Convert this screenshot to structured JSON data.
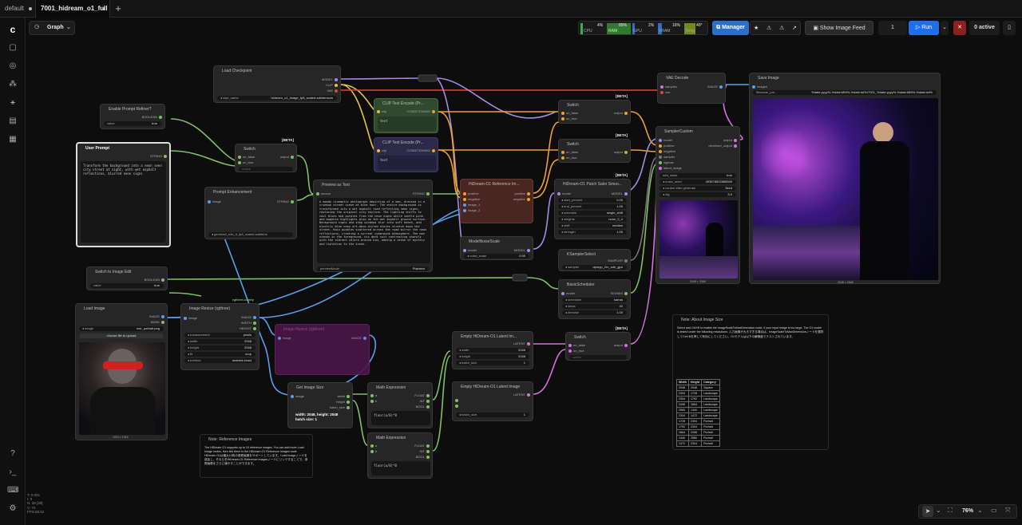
{
  "tabs": {
    "default": "default",
    "active": "7001_hidream_o1_full"
  },
  "toolbar": {
    "graph": "Graph",
    "manager": "Manager",
    "show_feed": "Show Image Feed",
    "run": "Run",
    "queue": "1",
    "active": "0 active",
    "cpu_label": "CPU",
    "cpu_val": "4%",
    "ram_label": "RAM",
    "ram_val": "85%",
    "gpu_label": "GPU",
    "gpu_val": "2%",
    "vram_label": "VRAM",
    "vram_val": "16%",
    "temp_label": "Temp",
    "temp_val": "40°"
  },
  "status": {
    "l1": "T: 0.00s",
    "l2": "I: 0",
    "l3": "N: 28 [28]",
    "l4": "V: 70",
    "l5": "FPS:59.52"
  },
  "zoom": "76%",
  "nodes": {
    "load_checkpoint": {
      "title": "Load Checkpoint",
      "model": "MODEL",
      "clip": "CLIP",
      "vae": "VAE",
      "ckpt_label": "ckpt_name",
      "ckpt_val": "hidream_o1_image_fp8_scaled.safetensors"
    },
    "enable_refiner": {
      "title": "Enable Prompt Refiner?",
      "out": "BOOLEAN",
      "w_label": "value",
      "w_val": "true"
    },
    "user_prompt": {
      "title": "User Prompt",
      "out": "STRING",
      "text": "Transform the background into a neon seen city street at night, with wet asphalt reflections, blurred neon signs"
    },
    "switch1": {
      "title": "Switch",
      "beta": "[BETA]",
      "on_false": "on_false",
      "on_true": "on_true",
      "out": "output",
      "sw": "switch"
    },
    "prompt_enh": {
      "title": "Prompt Enhancement",
      "image": "image",
      "out": "STRING",
      "model_val": "gemma4_e4b_it_fp8_scaled.safetens"
    },
    "preview_text": {
      "title": "Preview as Text",
      "source": "source",
      "out": "STRING",
      "text": "A moody cinematic photograph depicting of a man, dressed in a crimson street scene at blue hour. The entire background is transformed into a wet asphalt road reflecting neon signs, replacing the original city skyline. The lighting shifts to cool blues and purples from the neon signs while subtle pink and magenta highlights glow on the wet asphalt ground surface. Background signs and shop windows blur into soft bokeh, and electric blue neon art-deco-styled stores stretch down the street. Rain puddles scattered across the road mirror the neon reflections, creating a surreal cyberpunk atmosphere. The man stands in the foreground, his dark suit contrasting sharply with the vibrant colors around him, adding a sense of mystery and isolation to the scene.",
      "mode": "previewMode",
      "mode_val": "Plaintext"
    },
    "clip1": {
      "title": "CLIP Text Encode (Pr...",
      "clip": "clip",
      "out": "CONDITIONING",
      "text": "text"
    },
    "clip2": {
      "title": "CLIP Text Encode (Pr...",
      "clip": "clip",
      "out": "CONDITIONING",
      "text": "text"
    },
    "ref_images": {
      "title": "HiDream-O1 Reference Im...",
      "pos": "positive",
      "neg": "negative",
      "i1": "image_1",
      "i2": "image_2",
      "o1": "positive",
      "o2": "negative"
    },
    "switch_a": {
      "title": "Switch",
      "beta": "[BETA]",
      "on_false": "on_false",
      "on_true": "on_true",
      "out": "output",
      "sw_val": "0.81"
    },
    "switch_b": {
      "title": "Switch",
      "beta": "[BETA]",
      "on_false": "on_false",
      "on_true": "on_true",
      "out": "output",
      "sw_val": "0.0"
    },
    "patch": {
      "title": "HiDream-O1 Patch Salor Smoo...",
      "beta": "[BETA]",
      "model": "model",
      "out": "MODEL",
      "rows": [
        [
          "start_percent",
          "0.00"
        ],
        [
          "end_percent",
          "1.00"
        ],
        [
          "schedule",
          "single_shift"
        ],
        [
          "weights",
          "none_0_4"
        ],
        [
          "shift",
          "median"
        ],
        [
          "strength",
          "1.00"
        ]
      ]
    },
    "model_noise": {
      "title": "ModelNoiseScale",
      "model": "model",
      "out": "MODEL",
      "w": "noise_scale",
      "v": "0.95"
    },
    "vae_decode": {
      "title": "VAE Decode",
      "samples": "samples",
      "vae": "vae",
      "out": "IMAGE"
    },
    "sampler_custom": {
      "title": "SamplerCustom",
      "ins": [
        "model",
        "positive",
        "negative",
        "sampler",
        "sigmas",
        "latent_image"
      ],
      "o1": "output",
      "o2": "denoised_output",
      "rows": [
        [
          "add_noise",
          "true"
        ],
        [
          "noise_seed",
          "493578522868549"
        ],
        [
          "control after generate",
          "fixed"
        ],
        [
          "cfg",
          "5.0"
        ]
      ],
      "caption": "2048 × 2048"
    },
    "ksampler_select": {
      "title": "KSamplerSelect",
      "out": "SAMPLER",
      "w": "sampler",
      "v": "dpmpp_2m_sde_gpu"
    },
    "basic_sched": {
      "title": "BasicScheduler",
      "model": "model",
      "out": "SIGMAS",
      "rows": [
        [
          "scheduler",
          "karras"
        ],
        [
          "steps",
          "40"
        ],
        [
          "denoise",
          "1.00"
        ]
      ]
    },
    "save_image": {
      "title": "Save Image",
      "images": "images",
      "prefix": "filename_pre...",
      "prefix_val": "%date:yyyy%-%date:MM%-%date:dd%/7001_%date:yyyy%-%date:MM%-%date:dd%",
      "caption": "2048 × 2048"
    },
    "switch_edit": {
      "title": "Switch to Image Edit",
      "out": "BOOLEAN",
      "w": "value",
      "v": "true"
    },
    "load_image": {
      "title": "Load Image",
      "o1": "IMAGE",
      "o2": "MASK",
      "w": "image",
      "v": "noir_portrait.png",
      "upload": "choose file to upload",
      "caption": "1024 × 1024"
    },
    "resize": {
      "title": "Image Resize (rgthree)",
      "image": "image",
      "o1": "IMAGE",
      "o2": "WIDTH",
      "o3": "HEIGHT",
      "rows": [
        [
          "measurement",
          "pixels"
        ],
        [
          "width",
          "2048"
        ],
        [
          "height",
          "2048"
        ],
        [
          "fit",
          "crop"
        ],
        [
          "method",
          "nearest-exact"
        ]
      ],
      "tag": "rgthree-comfy"
    },
    "bypassed": {
      "title": "Image Resize (rgthree)",
      "image": "image",
      "out": "IMAGE"
    },
    "empty_latent": {
      "title": "Empty HiDream-O1 Latent Im...",
      "out": "LATENT",
      "rows": [
        [
          "width",
          "2048"
        ],
        [
          "height",
          "2048"
        ],
        [
          "batch_size",
          "1"
        ]
      ]
    },
    "switch_c": {
      "title": "Switch",
      "beta": "[BETA]",
      "on_false": "on_false",
      "on_true": "on_true",
      "out": "output",
      "sw": "switch"
    },
    "empty_latent2": {
      "title": "Empty HiDream-O1 Latent Image",
      "out": "LATENT",
      "w": "batch_size",
      "v": "1"
    },
    "get_size": {
      "title": "Get Image Size",
      "image": "image",
      "o1": "width",
      "o2": "height",
      "o3": "batch_size",
      "info": "width: 2048, height: 2048 batch size: 1"
    },
    "math1": {
      "title": "Math Expression",
      "a": "a",
      "b": "b",
      "o1": "FLOAT",
      "o2": "INT",
      "o3": "BOOL",
      "expr": "floor(a/8)*8"
    },
    "math2": {
      "title": "Math Expression",
      "a": "a",
      "b": "b",
      "o1": "FLOAT",
      "o2": "INT",
      "o3": "BOOL",
      "expr": "floor(a/8)*8"
    }
  },
  "notes": {
    "ref": {
      "title": "Note: Reference Images",
      "body": "The HiDream O1 supports up to 10 reference images. You can add more Load Image nodes, then link them to the HiDream-O1 Reference Images node. HiDream O1は最大10枚の参照画像をサポートしています。Load Imageノードを追加し、それらをHiDream-O1 Reference Imagesノードにリンクすることで、参照画像をさらに増やすことができます。"
    },
    "size": {
      "title": "Note: About Image Size",
      "body": "Select and Ctrl+B to enable the ImageScaleToMaxDimension node, if your input image is too large. The O1 model is tested under the following resolutions: 入力画像が大きすぎる場合は、ImageScaleToMaxDimensionノードを選択してCtrl+Bを押して有効にしてください。O1モデルは以下の解像度でテストされています。",
      "table": [
        [
          "Width",
          "Height",
          "Category"
        ],
        [
          "2048",
          "2048",
          "Square"
        ],
        [
          "2304",
          "1728",
          "Landscape"
        ],
        [
          "2304",
          "1792",
          "Landscape"
        ],
        [
          "2496",
          "1664",
          "Landscape"
        ],
        [
          "2560",
          "1440",
          "Landscape"
        ],
        [
          "2304",
          "1472",
          "Landscape"
        ],
        [
          "1728",
          "2304",
          "Portrait"
        ],
        [
          "1792",
          "2304",
          "Portrait"
        ],
        [
          "1664",
          "2496",
          "Portrait"
        ],
        [
          "1440",
          "2560",
          "Portrait"
        ],
        [
          "1472",
          "2304",
          "Portrait"
        ]
      ]
    }
  },
  "colors": {
    "bg": "#0d0d0d",
    "node": "#262626",
    "clip_green": "#2f4a2f",
    "clip_purple": "#2c2a48",
    "ref_red": "#4a2623",
    "run": "#1f6feb",
    "manager": "#2a6fc9"
  }
}
